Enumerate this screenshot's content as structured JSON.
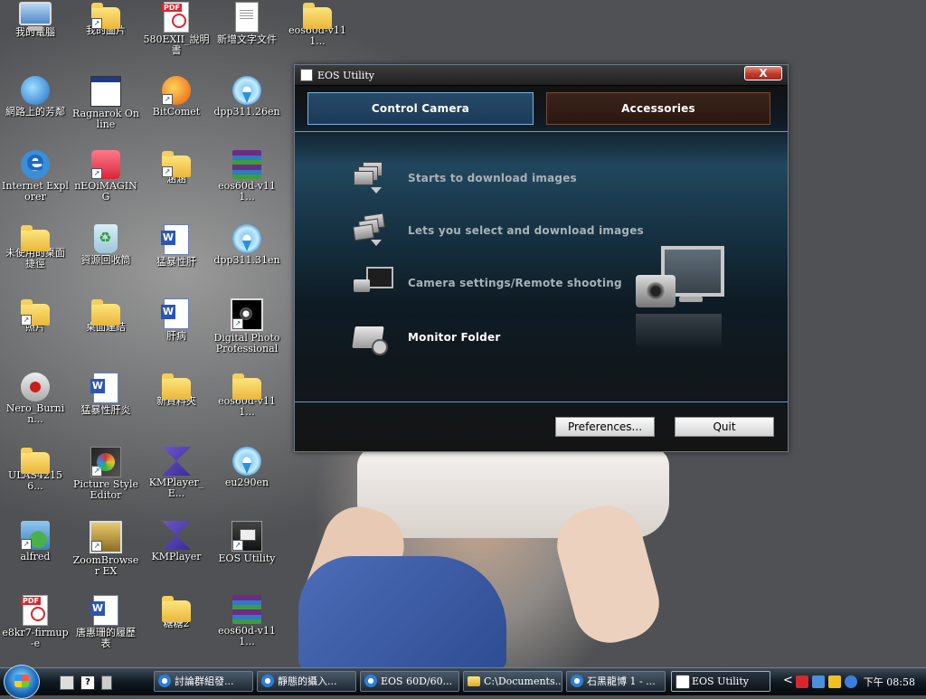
{
  "desktop": {
    "icons": [
      {
        "label": "我的電腦"
      },
      {
        "label": "我的圖片"
      },
      {
        "label": "580EXII_說明書"
      },
      {
        "label": "新增文字文件"
      },
      {
        "label": "eos60d-v111..."
      },
      {
        "label": "網路上的芳鄰"
      },
      {
        "label": "Ragnarok Online"
      },
      {
        "label": "BitComet"
      },
      {
        "label": "dpp311.26en"
      },
      {
        "label": "Internet Explorer"
      },
      {
        "label": "nEOiMAGING"
      },
      {
        "label": "涵涵"
      },
      {
        "label": "eos60d-v111..."
      },
      {
        "label": "未使用的桌面捷徑"
      },
      {
        "label": "資源回收筒"
      },
      {
        "label": "猛暴性肝"
      },
      {
        "label": "dpp311.31en"
      },
      {
        "label": "照片"
      },
      {
        "label": "桌面連結"
      },
      {
        "label": "肝病"
      },
      {
        "label": "Digital Photo Professional"
      },
      {
        "label": "Nero_Burnin..."
      },
      {
        "label": "猛暴性肝炎"
      },
      {
        "label": "新資料夾"
      },
      {
        "label": "eos60d-v111..."
      },
      {
        "label": "ULAS42156..."
      },
      {
        "label": "Picture Style Editor"
      },
      {
        "label": "KMPlayer_E..."
      },
      {
        "label": "eu290en"
      },
      {
        "label": "alfred"
      },
      {
        "label": "ZoomBrowser EX"
      },
      {
        "label": "KMPlayer"
      },
      {
        "label": "EOS Utility"
      },
      {
        "label": "e8kr7-firmup-e"
      },
      {
        "label": "唐惠珊的履歷表"
      },
      {
        "label": "糖糖2"
      },
      {
        "label": "eos60d-v111..."
      }
    ]
  },
  "window": {
    "title": "EOS Utility",
    "close_label": "X",
    "tabs": [
      {
        "label": "Control Camera"
      },
      {
        "label": "Accessories"
      }
    ],
    "menu": [
      {
        "label": "Starts to download images"
      },
      {
        "label": "Lets you select and download images"
      },
      {
        "label": "Camera settings/Remote shooting"
      },
      {
        "label": "Monitor Folder"
      }
    ],
    "buttons": {
      "preferences": "Preferences...",
      "quit": "Quit"
    }
  },
  "taskbar": {
    "quick_help": "?",
    "tasks": [
      {
        "label": "討論群組發..."
      },
      {
        "label": "靜態的攝入..."
      },
      {
        "label": "EOS 60D/60..."
      },
      {
        "label": "C:\\Documents..."
      },
      {
        "label": "石黑龍博 1 - ..."
      },
      {
        "label": "EOS Utility"
      }
    ],
    "tray_chevron": "<",
    "clock": "下午 08:58"
  }
}
